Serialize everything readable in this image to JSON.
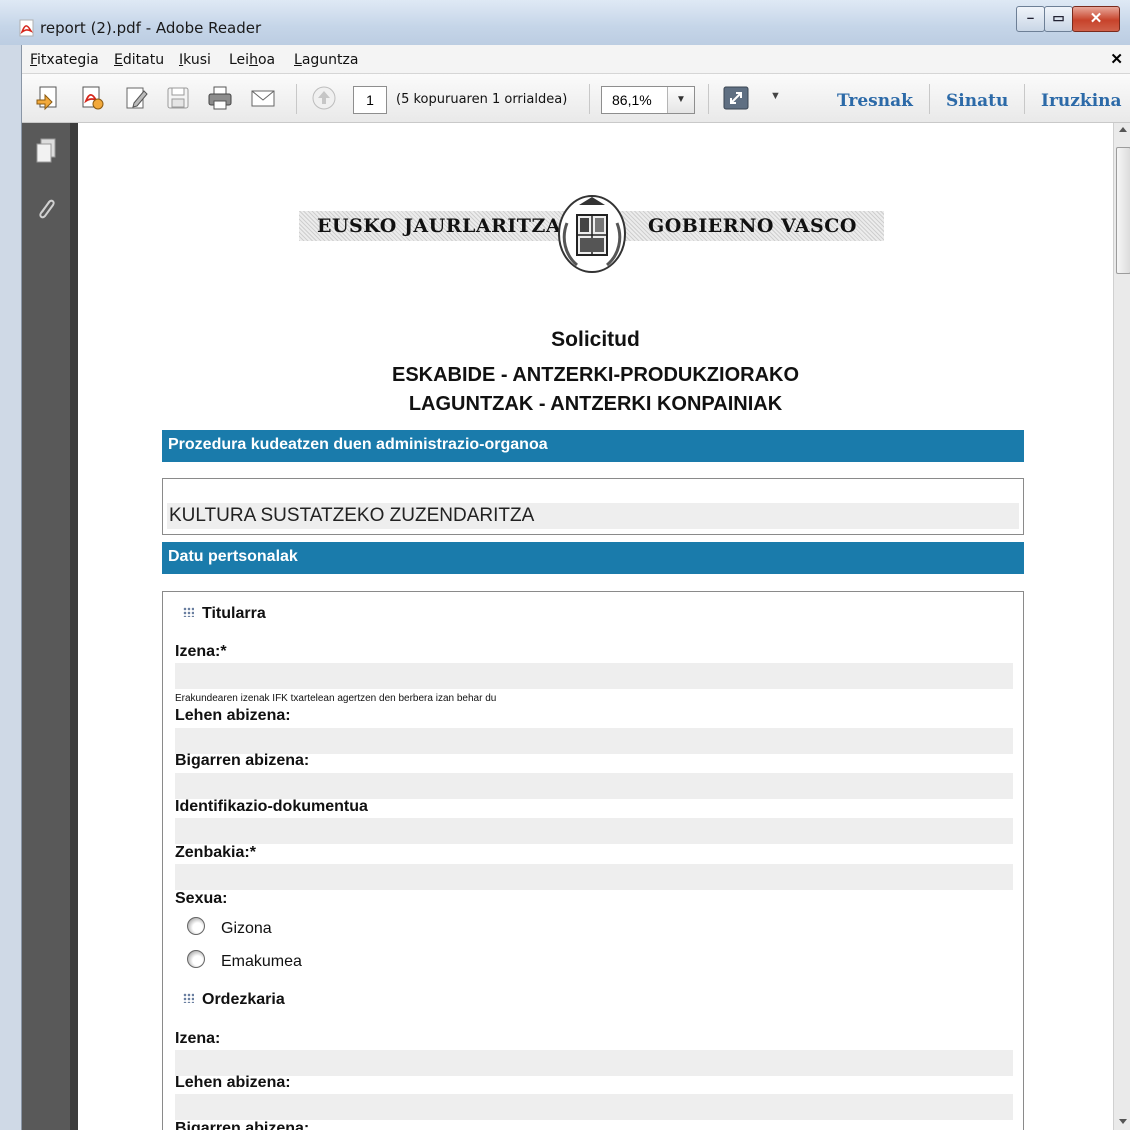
{
  "window": {
    "title": "report (2).pdf - Adobe Reader"
  },
  "menu": {
    "items": [
      {
        "label": "Fitxategia",
        "u": "F",
        "rest": "itxategia"
      },
      {
        "label": "Editatu",
        "u": "E",
        "rest": "ditatu"
      },
      {
        "label": "Ikusi",
        "u": "I",
        "rest": "kusi"
      },
      {
        "label": "Leihoa",
        "pre": "Lei",
        "u": "h",
        "rest": "oa"
      },
      {
        "label": "Laguntza",
        "u": "L",
        "rest": "aguntza"
      }
    ]
  },
  "toolbar": {
    "page_number": "1",
    "page_count": "(5 kopuruaren 1 orrialdea)",
    "zoom": "86,1%",
    "links": [
      "Tresnak",
      "Sinatu",
      "Iruzkina"
    ]
  },
  "document": {
    "logo_left": "EUSKO JAURLARITZA",
    "logo_right": "GOBIERNO VASCO",
    "title": "Solicitud",
    "subtitle_line1": "ESKABIDE - ANTZERKI-PRODUKZIORAKO",
    "subtitle_line2": "LAGUNTZAK - ANTZERKI KONPAINIAK",
    "section1_header": "Prozedura kudeatzen duen administrazio-organoa",
    "org_value": "KULTURA SUSTATZEKO ZUZENDARITZA",
    "section2_header": "Datu pertsonalak",
    "titular": {
      "heading": "Titularra",
      "name_label": "Izena:*",
      "name_hint": "Erakundearen izenak IFK txartelean agertzen den berbera izan behar du",
      "surname1_label": "Lehen abizena:",
      "surname2_label": "Bigarren abizena:",
      "id_doc_label": "Identifikazio-dokumentua",
      "number_label": "Zenbakia:*",
      "sex_label": "Sexua:",
      "sex_options": [
        "Gizona",
        "Emakumea"
      ]
    },
    "representative": {
      "heading": "Ordezkaria",
      "name_label": "Izena:",
      "surname1_label": "Lehen abizena:",
      "surname2_label": "Bigarren abizena:"
    }
  },
  "colors": {
    "section_bar": "#1a7bab",
    "link": "#2c6aa8",
    "field_bg": "#eeeeee"
  }
}
